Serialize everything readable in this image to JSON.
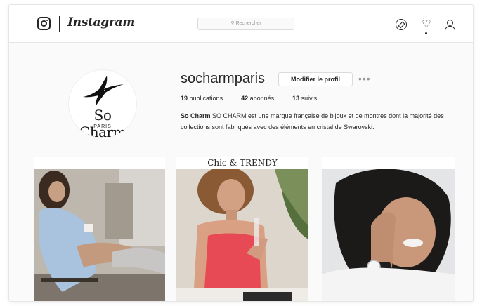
{
  "nav": {
    "brand": "Instagram",
    "search_placeholder": "Rechercher",
    "icons": [
      "instagram-glyph-icon",
      "compass-icon",
      "heart-icon",
      "user-icon"
    ]
  },
  "profile": {
    "username": "socharmparis",
    "edit_button": "Modifier le profil",
    "more_button": "•••",
    "avatar_logo": "So Charm",
    "avatar_logo_sub": "PARIS",
    "stats": [
      {
        "count": "19",
        "label": "publications"
      },
      {
        "count": "42",
        "label": "abonnés"
      },
      {
        "count": "13",
        "label": "suivis"
      }
    ],
    "bio_name": "So Charm",
    "bio_text": "SO CHARM est une marque française de bijoux et de montres dont la majorité des collections sont fabriqués avec des éléments en cristal de Swarovski."
  },
  "grid": {
    "tile2_banner": "Chic & TRENDY"
  },
  "colors": {
    "text": "#262626",
    "border": "#dbdbdb",
    "background": "#fafafa"
  }
}
